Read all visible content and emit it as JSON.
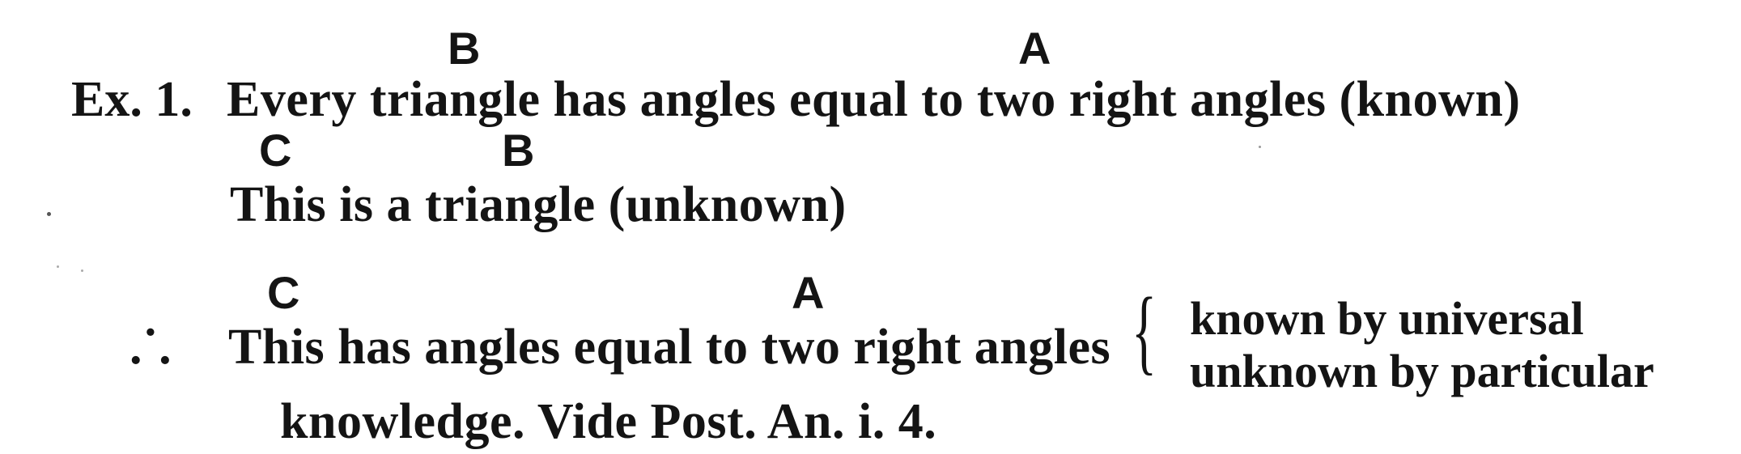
{
  "example_label": "Ex. 1.",
  "premise_major": {
    "text": "Every triangle has angles equal to two right angles (known)",
    "letter_b": "B",
    "letter_a": "A"
  },
  "premise_minor": {
    "text": "This is a triangle (unknown)",
    "letter_c": "C",
    "letter_b": "B"
  },
  "conclusion": {
    "therefore_symbol": ".˙.",
    "text": "This has angles equal to two right angles",
    "letter_c": "C",
    "letter_a": "A",
    "brace": "{",
    "brace_line_1": "known by universal",
    "brace_line_2": "unknown by particular"
  },
  "continuation": "knowledge.   Vide Post. An. i. 4."
}
